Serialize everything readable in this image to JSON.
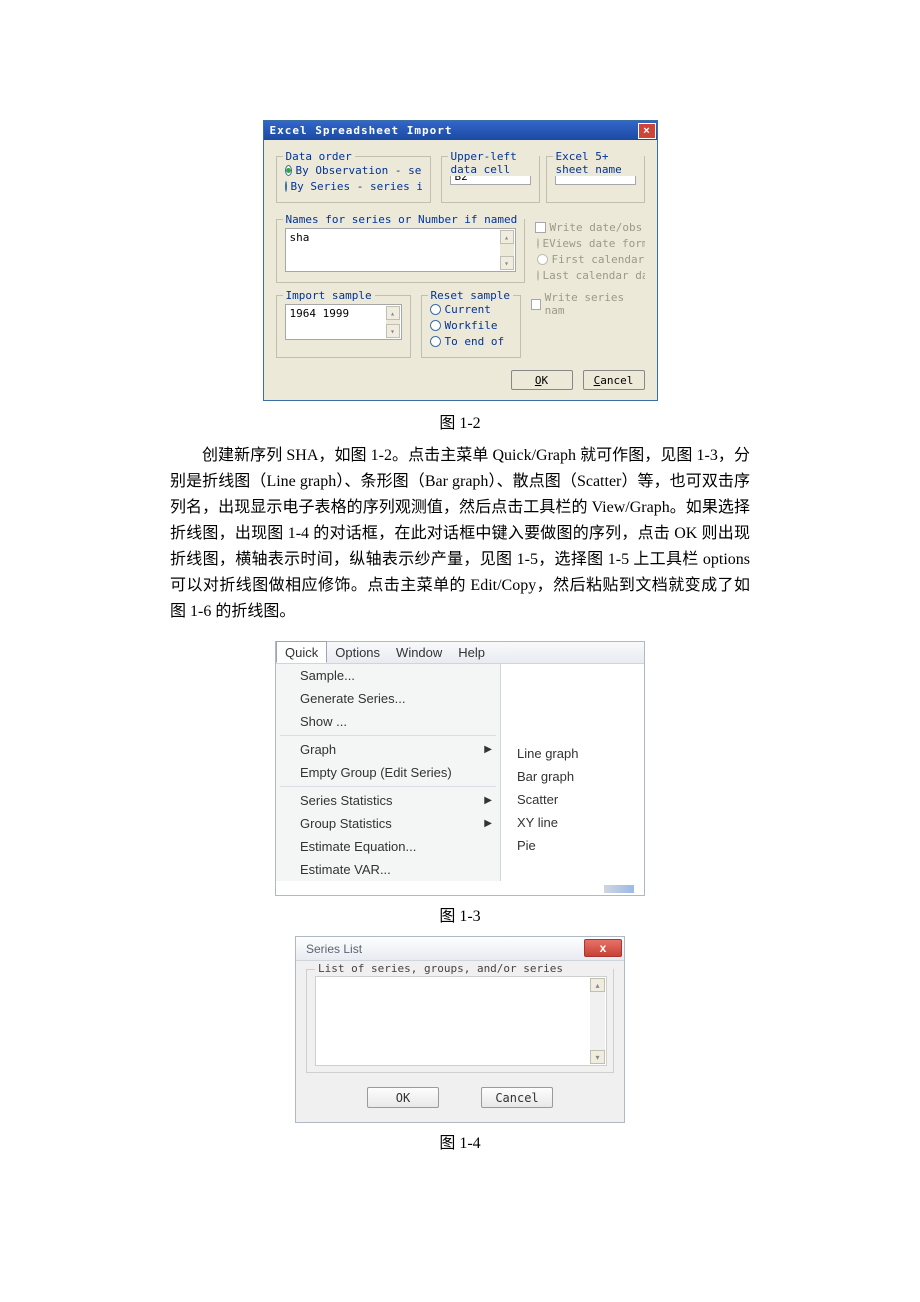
{
  "dlg1": {
    "title": "Excel Spreadsheet Import",
    "data_order": {
      "legend": "Data order",
      "opt1": "By Observation - series in c",
      "opt2": "By Series - series in r"
    },
    "upper_left": {
      "legend": "Upper-left data cell",
      "value": "B2"
    },
    "sheet": {
      "legend": "Excel 5+ sheet name",
      "value": ""
    },
    "names": {
      "legend": "Names for series or Number if named in file",
      "value": "sha"
    },
    "options": {
      "write": "Write date/obs",
      "eviews": "EViews date form",
      "first": "First calendar",
      "last": "Last calendar da",
      "series": "Write series nam"
    },
    "sample": {
      "legend": "Import sample",
      "value": "1964 1999"
    },
    "reset": {
      "legend": "Reset sample",
      "current": "Current",
      "workfile": "Workfile",
      "toend": "To end of"
    },
    "ok": "OK",
    "cancel": "Cancel"
  },
  "captions": {
    "c12": "图 1-2",
    "c13": "图 1-3",
    "c14": "图 1-4"
  },
  "paragraph": "创建新序列 SHA，如图 1-2。点击主菜单 Quick/Graph 就可作图，见图 1-3，分别是折线图（Line graph）、条形图（Bar graph）、散点图（Scatter）等，也可双击序列名，出现显示电子表格的序列观测值，然后点击工具栏的 View/Graph。如果选择折线图，出现图 1-4 的对话框，在此对话框中键入要做图的序列，点击 OK 则出现折线图，横轴表示时间，纵轴表示纱产量，见图 1-5，选择图 1-5 上工具栏 options 可以对折线图做相应修饰。点击主菜单的 Edit/Copy，然后粘贴到文档就变成了如图 1-6 的折线图。",
  "dlg2": {
    "menubar": [
      "Quick",
      "Options",
      "Window",
      "Help"
    ],
    "items": {
      "sample": "Sample...",
      "generate": "Generate Series...",
      "show": "Show ...",
      "graph": "Graph",
      "empty": "Empty Group (Edit Series)",
      "sstats": "Series Statistics",
      "gstats": "Group Statistics",
      "esteq": "Estimate Equation...",
      "estvar": "Estimate VAR..."
    },
    "submenu": {
      "line": "Line graph",
      "bar": "Bar graph",
      "scatter": "Scatter",
      "xy": "XY line",
      "pie": "Pie"
    }
  },
  "dlg3": {
    "title": "Series List",
    "legend": "List of series, groups, and/or series expressions",
    "ok": "OK",
    "cancel": "Cancel"
  }
}
